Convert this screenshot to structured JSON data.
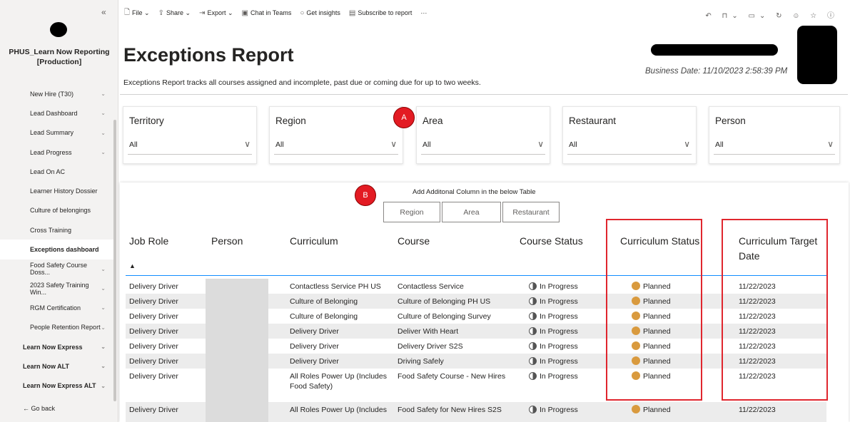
{
  "sidebar": {
    "collapse_glyph": "«",
    "app_title_line1": "PHUS_Learn Now Reporting",
    "app_title_line2": "[Production]",
    "items": [
      {
        "label": "New Hire (T30)",
        "chevron": "⌄",
        "level": "sub"
      },
      {
        "label": "Lead Dashboard",
        "chevron": "⌄",
        "level": "sub"
      },
      {
        "label": "Lead Summary",
        "chevron": "⌄",
        "level": "sub"
      },
      {
        "label": "Lead Progress",
        "chevron": "⌄",
        "level": "sub"
      },
      {
        "label": "Lead On AC",
        "chevron": "",
        "level": "sub"
      },
      {
        "label": "Learner History Dossier",
        "chevron": "",
        "level": "sub"
      },
      {
        "label": "Culture of belongings",
        "chevron": "",
        "level": "sub"
      },
      {
        "label": "Cross Training",
        "chevron": "",
        "level": "sub"
      },
      {
        "label": "Exceptions dashboard",
        "chevron": "",
        "level": "sub",
        "active": true
      },
      {
        "label": "Food Safety Course Doss...",
        "chevron": "⌄",
        "level": "sub"
      },
      {
        "label": "2023 Safety Training Win...",
        "chevron": "⌄",
        "level": "sub"
      },
      {
        "label": "RGM Certification",
        "chevron": "⌄",
        "level": "sub"
      },
      {
        "label": "People Retention Report",
        "chevron": "⌄",
        "level": "sub"
      },
      {
        "label": "Learn Now Express",
        "chevron": "⌄",
        "level": "top"
      },
      {
        "label": "Learn Now ALT",
        "chevron": "⌄",
        "level": "top"
      },
      {
        "label": "Learn Now Express ALT",
        "chevron": "⌄",
        "level": "top"
      }
    ],
    "go_back": "← Go back"
  },
  "toolbar": {
    "file": "File ⌄",
    "share": "Share ⌄",
    "export": "Export ⌄",
    "chat": "Chat in Teams",
    "insights": "Get insights",
    "subscribe": "Subscribe to report",
    "more": "···",
    "right_icons": "↶ ⊓⌄ ▭⌄ ↻ ☺ ☆ ⓘ"
  },
  "header": {
    "title": "Exceptions Report",
    "subtitle": "Exceptions Report tracks all courses assigned and incomplete, past due or coming due for up to two weeks.",
    "business_date": "Business Date: 11/10/2023 2:58:39 PM"
  },
  "filters": [
    {
      "label": "Territory",
      "value": "All"
    },
    {
      "label": "Region",
      "value": "All"
    },
    {
      "label": "Area",
      "value": "All"
    },
    {
      "label": "Restaurant",
      "value": "All"
    },
    {
      "label": "Person",
      "value": "All"
    }
  ],
  "markers": {
    "a": "A",
    "b": "B"
  },
  "add_columns": {
    "label": "Add Additonal Column in the below Table",
    "buttons": [
      "Region",
      "Area",
      "Restaurant"
    ]
  },
  "table": {
    "headers": [
      "Job Role",
      "Person",
      "Curriculum",
      "Course",
      "Course Status",
      "Curriculum Status",
      "Curriculum Target",
      "Date"
    ],
    "sort_glyph": "▲",
    "rows": [
      {
        "job_role": "Delivery Driver",
        "curriculum": "Contactless Service PH US",
        "curriculum2": "",
        "course": "Contactless Service",
        "course_status": "In Progress",
        "curriculum_status": "Planned",
        "target_date": "11/22/2023"
      },
      {
        "job_role": "Delivery Driver",
        "curriculum": "Culture of Belonging",
        "curriculum2": "",
        "course": "Culture of Belonging PH US",
        "course_status": "In Progress",
        "curriculum_status": "Planned",
        "target_date": "11/22/2023"
      },
      {
        "job_role": "Delivery Driver",
        "curriculum": "Culture of Belonging",
        "curriculum2": "",
        "course": "Culture of Belonging Survey",
        "course_status": "In Progress",
        "curriculum_status": "Planned",
        "target_date": "11/22/2023"
      },
      {
        "job_role": "Delivery Driver",
        "curriculum": "Delivery Driver",
        "curriculum2": "",
        "course": "Deliver With Heart",
        "course_status": "In Progress",
        "curriculum_status": "Planned",
        "target_date": "11/22/2023"
      },
      {
        "job_role": "Delivery Driver",
        "curriculum": "Delivery Driver",
        "curriculum2": "",
        "course": "Delivery Driver S2S",
        "course_status": "In Progress",
        "curriculum_status": "Planned",
        "target_date": "11/22/2023"
      },
      {
        "job_role": "Delivery Driver",
        "curriculum": "Delivery Driver",
        "curriculum2": "",
        "course": "Driving Safely",
        "course_status": "In Progress",
        "curriculum_status": "Planned",
        "target_date": "11/22/2023"
      },
      {
        "job_role": "Delivery Driver",
        "curriculum": "All Roles Power Up (Includes",
        "curriculum2": "Food Safety)",
        "course": "Food Safety Course - New Hires",
        "course_status": "In Progress",
        "curriculum_status": "Planned",
        "target_date": "11/22/2023"
      },
      {
        "job_role": "Delivery Driver",
        "curriculum": "All Roles Power Up (Includes",
        "curriculum2": "",
        "course": "Food Safety for New Hires S2S",
        "course_status": "In Progress",
        "curriculum_status": "Planned",
        "target_date": "11/22/2023"
      }
    ]
  }
}
